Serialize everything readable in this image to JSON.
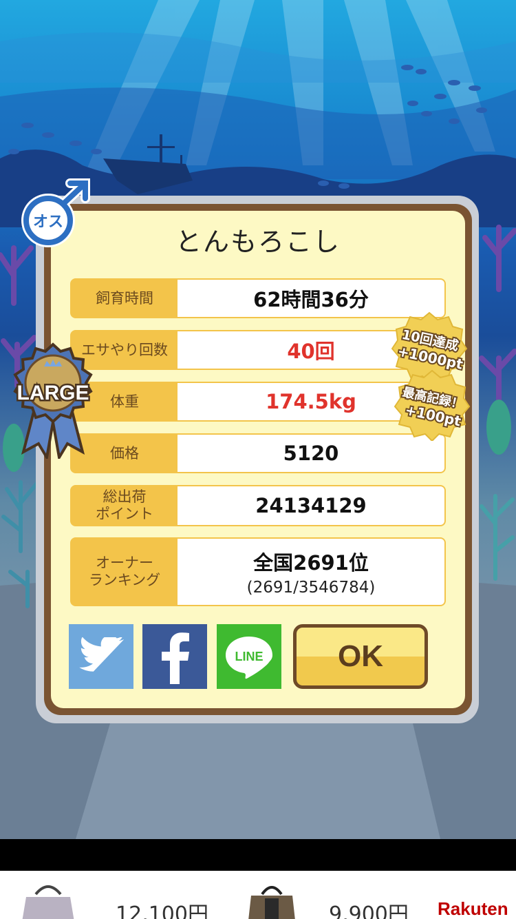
{
  "fish": {
    "name": "とんもろこし",
    "gender_label": "オス",
    "size_badge": "LARGE"
  },
  "stats": [
    {
      "label": "飼育時間",
      "value": "62時間36分",
      "highlight": false
    },
    {
      "label": "エサやり回数",
      "value": "40回",
      "highlight": true
    },
    {
      "label": "体重",
      "value": "174.5kg",
      "highlight": true
    },
    {
      "label": "価格",
      "value": "5120",
      "highlight": false
    },
    {
      "label_line1": "総出荷",
      "label_line2": "ポイント",
      "value": "24134129",
      "highlight": false
    },
    {
      "label_line1": "オーナー",
      "label_line2": "ランキング",
      "value": "全国2691位",
      "sub": "(2691/3546784)",
      "highlight": false
    }
  ],
  "bonuses": [
    {
      "line1": "10回達成",
      "line2": "+1000pt"
    },
    {
      "line1": "最高記録！",
      "line2": "+100pt"
    }
  ],
  "buttons": {
    "ok": "OK",
    "line": "LINE"
  },
  "icons": {
    "twitter": "twitter-bird-icon",
    "facebook": "facebook-f-icon",
    "line": "line-chat-icon",
    "gender": "male-symbol-icon",
    "ribbon": "ribbon-medal-icon"
  },
  "ad": {
    "price1": "12,100円",
    "price2": "9,900円",
    "brand": "Rakuten"
  },
  "colors": {
    "card_border": "#7a5432",
    "card_fill": "#fdf9c4",
    "label_fill": "#f3c44a",
    "highlight_text": "#e0332c",
    "twitter": "#6fa8dc",
    "facebook": "#3b5998",
    "line": "#3fba30"
  }
}
